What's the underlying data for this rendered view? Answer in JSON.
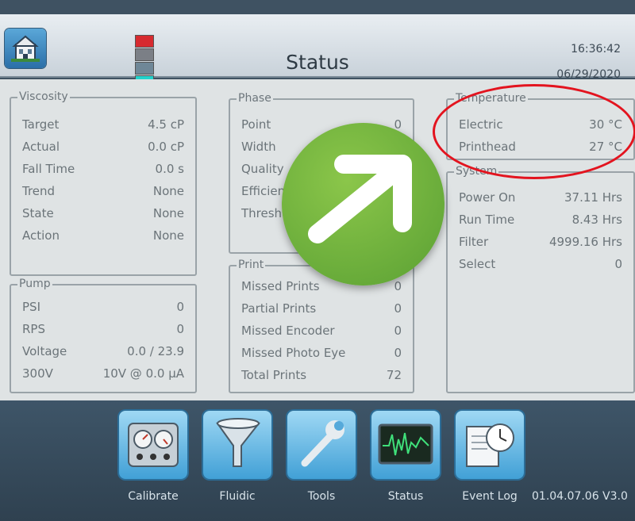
{
  "header": {
    "title": "Status",
    "time": "16:36:42",
    "date": "06/29/2020",
    "swatch_colors": [
      "#d62a2f",
      "#7b7f86",
      "#6f8797",
      "#22d3cc"
    ]
  },
  "viscosity": {
    "title": "Viscosity",
    "rows": [
      {
        "label": "Target",
        "value": "4.5 cP"
      },
      {
        "label": "Actual",
        "value": "0.0 cP"
      },
      {
        "label": "Fall Time",
        "value": "0.0 s"
      },
      {
        "label": "Trend",
        "value": "None"
      },
      {
        "label": "State",
        "value": "None"
      },
      {
        "label": "Action",
        "value": "None"
      }
    ]
  },
  "pump": {
    "title": "Pump",
    "rows": [
      {
        "label": "PSI",
        "value": "0"
      },
      {
        "label": "RPS",
        "value": "0"
      },
      {
        "label": "Voltage",
        "value": "0.0 / 23.9"
      },
      {
        "label": "300V",
        "value": "10V @ 0.0 μA"
      }
    ]
  },
  "phase": {
    "title": "Phase",
    "rows": [
      {
        "label": "Point",
        "value": "0"
      },
      {
        "label": "Width",
        "value": ""
      },
      {
        "label": "Quality",
        "value": ""
      },
      {
        "label": "Efficien",
        "value": ""
      },
      {
        "label": "Thresh",
        "value": ""
      }
    ]
  },
  "print": {
    "title": "Print",
    "rows": [
      {
        "label": "Missed Prints",
        "value": "0"
      },
      {
        "label": "Partial Prints",
        "value": "0"
      },
      {
        "label": "Missed Encoder",
        "value": "0"
      },
      {
        "label": "Missed Photo Eye",
        "value": "0"
      },
      {
        "label": "Total Prints",
        "value": "72"
      }
    ]
  },
  "temperature": {
    "title": "Temperature",
    "rows": [
      {
        "label": "Electric",
        "value": "30 °C"
      },
      {
        "label": "Printhead",
        "value": "27 °C"
      }
    ]
  },
  "system": {
    "title": "System",
    "rows": [
      {
        "label": "Power On",
        "value": "37.11 Hrs"
      },
      {
        "label": "Run Time",
        "value": "8.43 Hrs"
      },
      {
        "label": "Filter",
        "value": "4999.16 Hrs"
      },
      {
        "label": "Select",
        "value": "0"
      }
    ]
  },
  "dock": {
    "buttons": [
      {
        "label": "Calibrate",
        "icon": "gauges-icon"
      },
      {
        "label": "Fluidic",
        "icon": "funnel-icon"
      },
      {
        "label": "Tools",
        "icon": "wrench-icon"
      },
      {
        "label": "Status",
        "icon": "monitor-waveform-icon"
      },
      {
        "label": "Event Log",
        "icon": "clock-document-icon"
      }
    ],
    "version": "01.04.07.06 V3.0"
  },
  "overlay": {
    "arrow_icon": "arrow-up-right-icon",
    "highlight_color": "#e3141f",
    "badge_color": "#6db33f"
  }
}
